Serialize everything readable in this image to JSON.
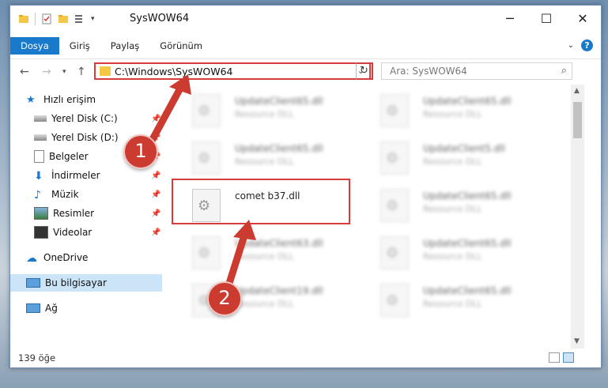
{
  "window": {
    "title": "SysWOW64"
  },
  "ribbon": {
    "tabs": [
      {
        "label": "Dosya",
        "active": true
      },
      {
        "label": "Giriş"
      },
      {
        "label": "Paylaş"
      },
      {
        "label": "Görünüm"
      }
    ],
    "help": "?"
  },
  "nav": {
    "address": "C:\\Windows\\SysWOW64",
    "search_placeholder": "Ara: SysWOW64"
  },
  "sidebar": {
    "items": [
      {
        "label": "Hızlı erişim",
        "icon": "star-icon"
      },
      {
        "label": "Yerel Disk (C:)",
        "icon": "drive-icon",
        "pinned": true
      },
      {
        "label": "Yerel Disk (D:)",
        "icon": "drive-icon",
        "pinned": true
      },
      {
        "label": "Belgeler",
        "icon": "documents-icon",
        "pinned": true
      },
      {
        "label": "İndirmeler",
        "icon": "downloads-icon",
        "pinned": true
      },
      {
        "label": "Müzik",
        "icon": "music-icon",
        "pinned": true
      },
      {
        "label": "Resimler",
        "icon": "pictures-icon",
        "pinned": true
      },
      {
        "label": "Videolar",
        "icon": "videos-icon",
        "pinned": true
      },
      {
        "label": "OneDrive",
        "icon": "cloud-icon"
      },
      {
        "label": "Bu bilgisayar",
        "icon": "computer-icon",
        "selected": true
      },
      {
        "label": "Ağ",
        "icon": "network-icon"
      }
    ]
  },
  "files": [
    {
      "name": "UpdateClient65.dll",
      "desc": "Resource DLL",
      "blurred": true
    },
    {
      "name": "UpdateClient65.dll",
      "desc": "Resource DLL",
      "blurred": true
    },
    {
      "name": "UpdateClient65.dll",
      "desc": "Resource DLL",
      "blurred": true
    },
    {
      "name": "UpdateClient5.dll",
      "desc": "Resource DLL",
      "blurred": true
    },
    {
      "name": "comet b37.dll",
      "desc": "",
      "blurred": false
    },
    {
      "name": "UpdateClient65.dll",
      "desc": "Resource DLL",
      "blurred": true
    },
    {
      "name": "UpdateClient63.dll",
      "desc": "Resource DLL",
      "blurred": true
    },
    {
      "name": "UpdateClient65.dll",
      "desc": "Resource DLL",
      "blurred": true
    },
    {
      "name": "UpdateClient19.dll",
      "desc": "Resource DLL",
      "blurred": true
    },
    {
      "name": "UpdateClient65.dll",
      "desc": "Resource DLL",
      "blurred": true
    }
  ],
  "status": {
    "count": "139 öğe"
  },
  "annotations": {
    "step1": "1",
    "step2": "2"
  },
  "colors": {
    "accent": "#1979ca",
    "annotation": "#cc3b2f",
    "highlight_border": "#d83b3b",
    "selected": "#cce4f7"
  }
}
